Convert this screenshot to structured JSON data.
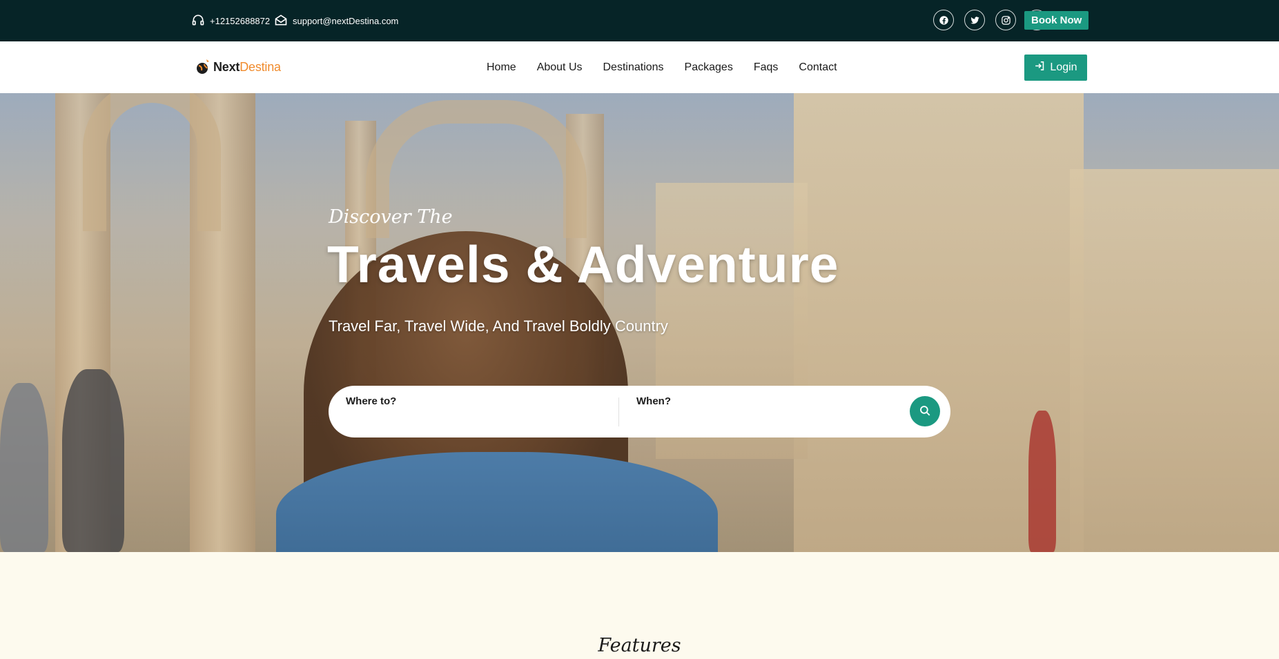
{
  "topbar": {
    "phone": "+12152688872",
    "email": "support@nextDestina.com",
    "socials": [
      "facebook",
      "twitter",
      "instagram",
      "linkedin"
    ],
    "book_now": "Book Now"
  },
  "brand": {
    "name_part1": "Next",
    "name_part2": "Destina"
  },
  "nav": {
    "items": [
      "Home",
      "About Us",
      "Destinations",
      "Packages",
      "Faqs",
      "Contact"
    ],
    "login": "Login"
  },
  "hero": {
    "eyebrow": "Discover The",
    "headline": "Travels & Adventure",
    "subhead": "Travel Far, Travel Wide, And Travel Boldly Country"
  },
  "search": {
    "where_label": "Where to?",
    "when_label": "When?"
  },
  "section": {
    "features_title": "Features"
  },
  "colors": {
    "topbar_bg": "#062427",
    "accent": "#1b9981",
    "brand_orange": "#f08b2d",
    "section_bg": "#fdfaee"
  }
}
